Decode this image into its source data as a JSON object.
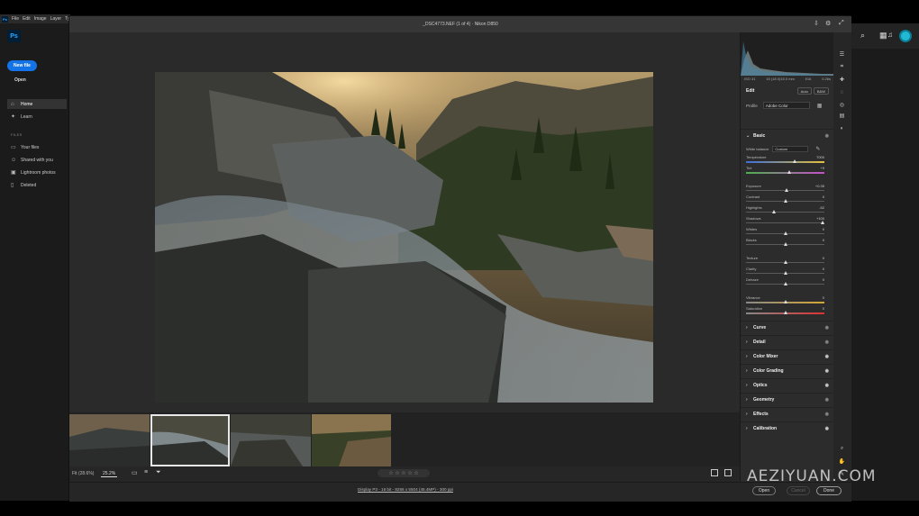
{
  "ps": {
    "menu": [
      "File",
      "Edit",
      "Image",
      "Layer",
      "Ty"
    ],
    "logo": "Ps",
    "new_file": "New file",
    "open": "Open",
    "nav": [
      {
        "label": "Home",
        "icon": "home-icon"
      },
      {
        "label": "Learn",
        "icon": "lightbulb-icon"
      }
    ],
    "files_heading": "FILES",
    "files": [
      {
        "label": "Your files",
        "icon": "folder-icon"
      },
      {
        "label": "Shared with you",
        "icon": "people-icon"
      },
      {
        "label": "Lightroom photos",
        "icon": "lightroom-icon"
      },
      {
        "label": "Deleted",
        "icon": "trash-icon"
      }
    ]
  },
  "cr": {
    "title": "_DSC4773.NEF (1 of 4)  ·  Nikon D850",
    "fit_label": "Fit (28.6%)",
    "zoom": "25.2%",
    "file_info": "Display P3 - 16 bit - 8256 x 5504 (45.4MP) - 300 ppi",
    "open_label": "Open",
    "cancel_label": "Cancel",
    "done_label": "Done",
    "rating_stars": "☆ ☆ ☆ ☆ ☆",
    "histogram_meta": [
      "ISO 31",
      "15 (18.0)15.0 mm",
      "f/16",
      "0.26s"
    ],
    "edit_title": "Edit",
    "auto_label": "Auto",
    "bw_label": "B&W",
    "profile_label": "Profile",
    "profile_value": "Adobe Color",
    "basic_title": "Basic",
    "wb_label": "White balance",
    "wb_value": "Custom",
    "sliders": [
      {
        "label": "Temperature",
        "value": "7000"
      },
      {
        "label": "Tint",
        "value": "+9"
      },
      {
        "label": "Exposure",
        "value": "+0.35"
      },
      {
        "label": "Contrast",
        "value": "0"
      },
      {
        "label": "Highlights",
        "value": "-52"
      },
      {
        "label": "Shadows",
        "value": "+100"
      },
      {
        "label": "Whites",
        "value": "0"
      },
      {
        "label": "Blacks",
        "value": "0"
      },
      {
        "label": "Texture",
        "value": "0"
      },
      {
        "label": "Clarity",
        "value": "0"
      },
      {
        "label": "Dehaze",
        "value": "0"
      },
      {
        "label": "Vibrance",
        "value": "0"
      },
      {
        "label": "Saturation",
        "value": "0"
      }
    ],
    "sections": [
      "Curve",
      "Detail",
      "Color Mixer",
      "Color Grading",
      "Optics",
      "Geometry",
      "Effects",
      "Calibration"
    ]
  },
  "watermark": "AEZIYUAN.COM",
  "colors": {
    "accent": "#1473e6",
    "avatar": "#22b8d4"
  }
}
